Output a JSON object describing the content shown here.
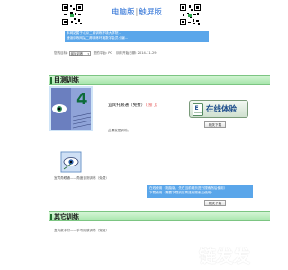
{
  "header": {
    "desktop_link": "电脑版",
    "separator": "|",
    "touch_link": "触屏版"
  },
  "intro": {
    "line1": "本网站属于北京二卿训练环境大学院...",
    "line2": "速读训练网站二卿训练环境数字会员小编..."
  },
  "settings": {
    "training_label": "您的目标:",
    "training_value": "阅读训练",
    "platform_label": "您的平台:",
    "platform_value": "PC",
    "date_label": "训练开始日期:",
    "date_value": "2014-11-29"
  },
  "section1": {
    "title": "目测训练"
  },
  "course1": {
    "title": "宜宾托眼通（免费）",
    "hot": "（热门）",
    "subtitle": "此课就是训练。",
    "experience_label": "在线体验",
    "download_label": "相关下载"
  },
  "course2": {
    "label": "宜宾角眼通——角度目测训练（免费）"
  },
  "notice": {
    "line1": "在线使用（电脑版，先在当前网页进行搜索然后使用）",
    "line2": "下载使用（需要下载安装再进行搜索后使用）"
  },
  "download2_label": "相关下载",
  "section2": {
    "title": "其它训练"
  },
  "course3": {
    "label": "宜宾数字符——手写阅读训练（免费）"
  },
  "watermark": {
    "text": "链发发"
  },
  "colors": {
    "accent_blue": "#5aa6ea",
    "link_blue": "#2a6fd6",
    "section_green": "#a9e6ad",
    "hot_red": "#e03030"
  }
}
